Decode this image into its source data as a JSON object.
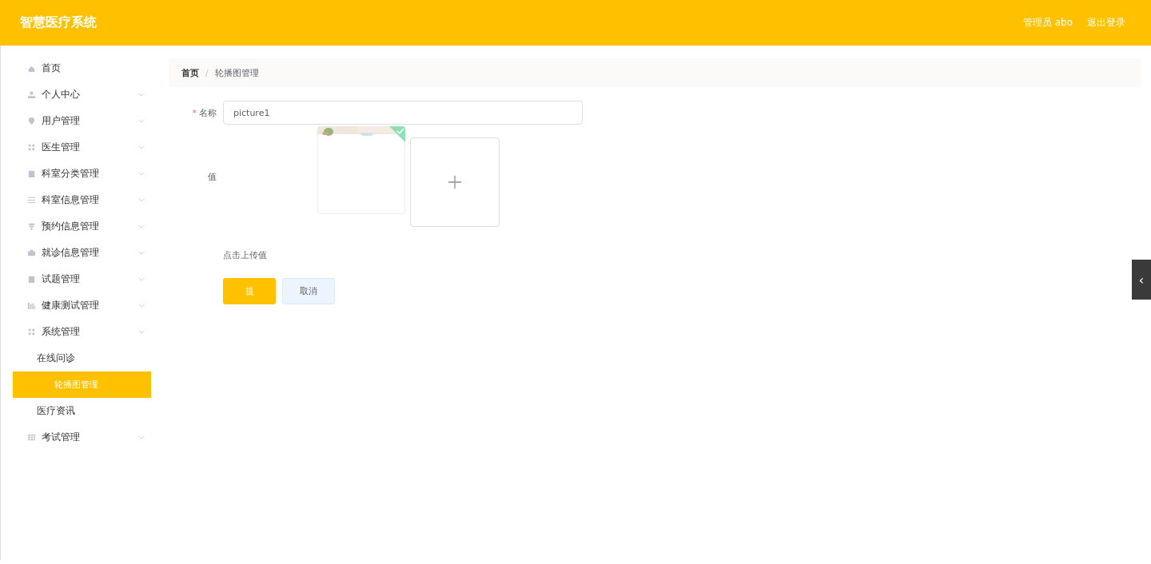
{
  "header": {
    "title": "智慧医疗系统",
    "user": "管理员 abo",
    "logout": "退出登录"
  },
  "sidebar": {
    "items": [
      {
        "label": "首页",
        "expandable": false
      },
      {
        "label": "个人中心",
        "expandable": true
      },
      {
        "label": "用户管理",
        "expandable": true
      },
      {
        "label": "医生管理",
        "expandable": true
      },
      {
        "label": "科室分类管理",
        "expandable": true
      },
      {
        "label": "科室信息管理",
        "expandable": true
      },
      {
        "label": "预约信息管理",
        "expandable": true
      },
      {
        "label": "就诊信息管理",
        "expandable": true
      },
      {
        "label": "试题管理",
        "expandable": true
      },
      {
        "label": "健康测试管理",
        "expandable": true
      },
      {
        "label": "系统管理",
        "expandable": true,
        "children": [
          {
            "label": "在线问诊",
            "selected": false
          },
          {
            "label": "轮播图管理",
            "selected": true
          },
          {
            "label": "医疗资讯",
            "selected": false
          }
        ]
      },
      {
        "label": "考试管理",
        "expandable": true
      }
    ]
  },
  "breadcrumb": [
    "首页",
    "轮播图管理"
  ],
  "breadcrumb_separator": "/",
  "form": {
    "name_label": "名称",
    "name_required_mark": "*",
    "name_value": "picture1",
    "value_label": "值",
    "uploaded": [
      {
        "kind": "picture",
        "success": true
      }
    ],
    "upload_hint": "点击上传值",
    "buttons": [
      {
        "label": "提",
        "kind": "primary"
      },
      {
        "label": "取消",
        "kind": "secondary"
      }
    ]
  },
  "side_toggle": {
    "icon": "‹"
  }
}
